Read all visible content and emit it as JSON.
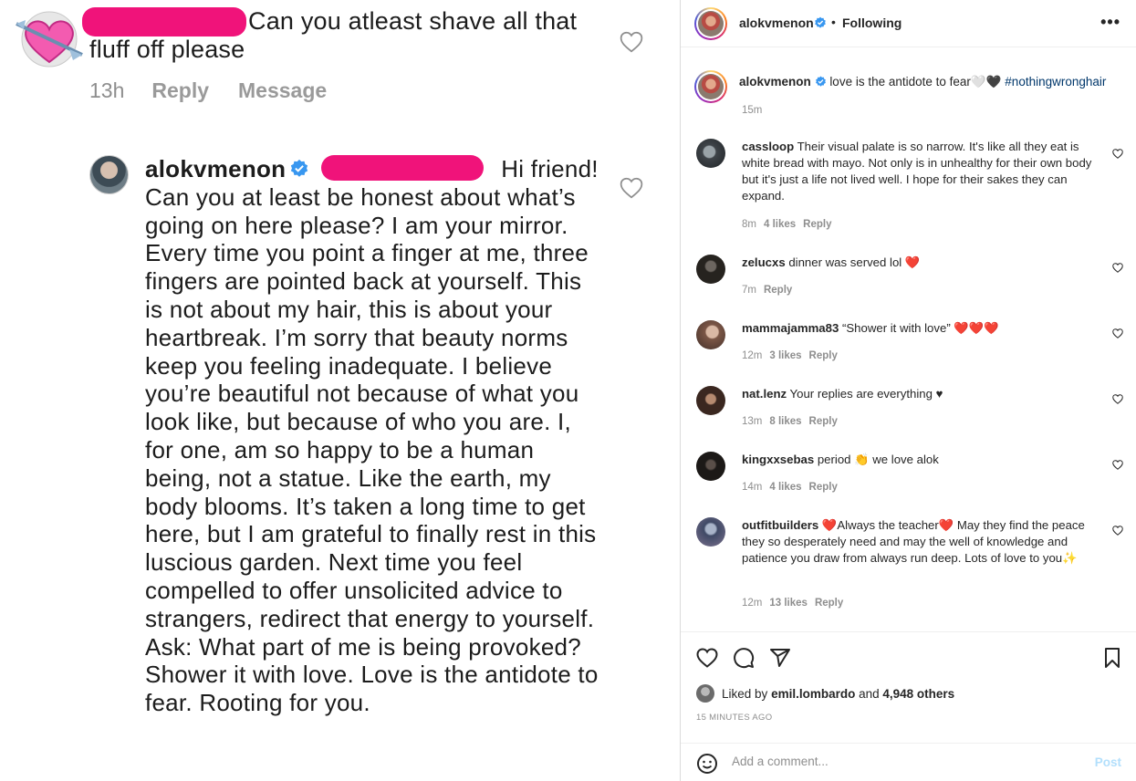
{
  "left_image": {
    "comment1": {
      "text": "Can you atleast shave all that fluff off please",
      "time": "13h",
      "reply": "Reply",
      "message": "Message"
    },
    "comment2": {
      "username": "alokvmenon",
      "text": "Hi friend! Can you at least be honest about what’s going on here please? I am your mirror. Every time you point a finger at me, three fingers are pointed back at yourself. This is not about my hair, this is about your heartbreak. I’m sorry that beauty norms keep you feeling inadequate. I believe you’re beautiful not because of what you look like, but because of who you are. I, for one, am so happy to be a human being, not a statue. Like the earth, my body blooms. It’s taken a long time to get here, but I am grateful to finally rest in this luscious garden. Next time you feel compelled to offer unsolicited advice to strangers, redirect that energy to yourself. Ask: What part of me is being provoked? Shower it with love. Love is the antidote to fear. Rooting for you."
    }
  },
  "header": {
    "username": "alokvmenon",
    "separator": "•",
    "follow_state": "Following",
    "more": "•••"
  },
  "caption": {
    "username": "alokvmenon",
    "text": "love is the antidote to fear🤍🖤",
    "hashtag": "#nothingwronghair",
    "time": "15m"
  },
  "comments": [
    {
      "username": "cassloop",
      "text": "Their visual palate is so narrow. It's like all they eat is white bread with mayo. Not only is in unhealthy for their own body but it's just a life not lived well. I hope for their sakes they can expand.",
      "time": "8m",
      "likes": "4 likes",
      "reply": "Reply"
    },
    {
      "username": "zelucxs",
      "text": "dinner was served lol ❤️",
      "time": "7m",
      "likes": "",
      "reply": "Reply"
    },
    {
      "username": "mammajamma83",
      "text": "“Shower it with love” ❤️❤️❤️",
      "time": "12m",
      "likes": "3 likes",
      "reply": "Reply"
    },
    {
      "username": "nat.lenz",
      "text": "Your replies are everything ♥",
      "time": "13m",
      "likes": "8 likes",
      "reply": "Reply"
    },
    {
      "username": "kingxxsebas",
      "text": "period 👏 we love alok",
      "time": "14m",
      "likes": "4 likes",
      "reply": "Reply"
    },
    {
      "username": "outfitbuilders",
      "text": "❤️Always the teacher❤️ May they find the peace they so desperately need and may the well of knowledge and patience you draw from always run deep. Lots of love to you✨",
      "time": "12m",
      "likes": "13 likes",
      "reply": "Reply"
    }
  ],
  "likes": {
    "prefix": "Liked by",
    "user": "emil.lombardo",
    "and": "and",
    "others": "4,948 others"
  },
  "posted_ago": "15 MINUTES AGO",
  "add_comment": {
    "placeholder": "Add a comment...",
    "post_label": "Post"
  },
  "colors": {
    "redaction": "#f0137a",
    "verified": "#3897f0",
    "hashtag": "#00376b",
    "heart_red": "#ed4956",
    "post_disabled": "#b2dffc"
  }
}
